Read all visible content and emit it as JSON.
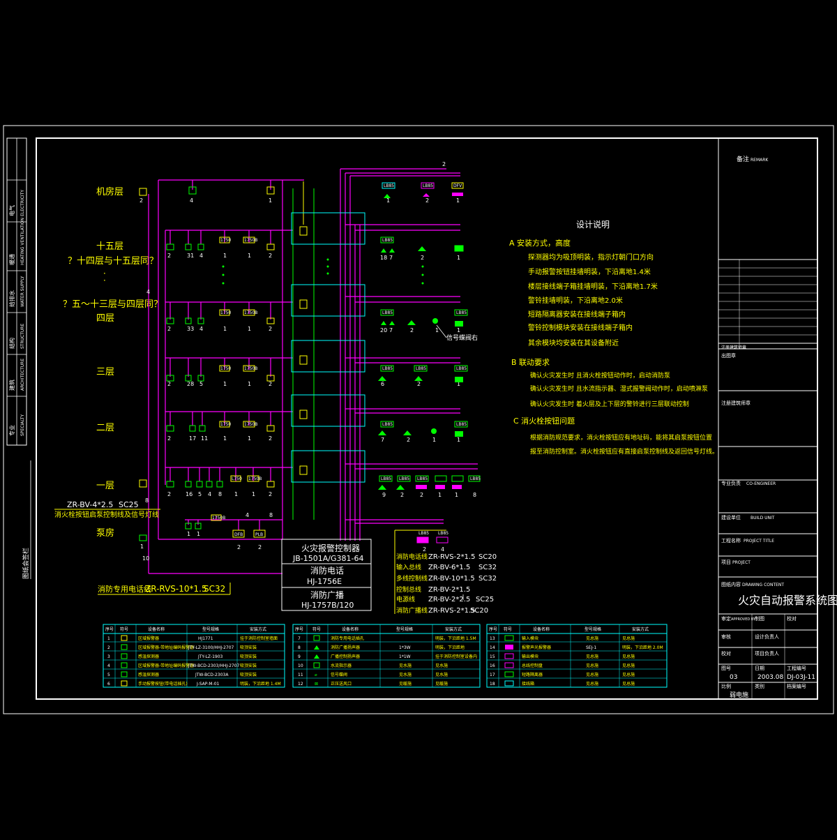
{
  "colors": {
    "background": "#000000",
    "frame": "#ffffff",
    "wire_magenta": "#ff00ff",
    "text_yellow": "#ffff00",
    "device_green": "#00ff00",
    "box_cyan": "#00ffff"
  },
  "floors": {
    "machine_room": "机房层",
    "f15": "十五层",
    "f14_15": "？十四层与十五层同？",
    "f5_13": "？五～十三层与四层同？",
    "f4": "四层",
    "f3": "三层",
    "f2": "二层",
    "f1": "一层",
    "pump_room": "泵房"
  },
  "counts": {
    "mr_2": "2",
    "mr_4": "4",
    "mr_1": "1",
    "f15_2a": "2",
    "f15_31": "31",
    "f15_4": "4",
    "f15_1a": "1",
    "f15_1b": "1",
    "f15_2b": "2",
    "f4_2a": "2",
    "f4_33": "33",
    "f4_4": "4",
    "f4_1a": "1",
    "f4_1b": "1",
    "f4_2b": "2",
    "f3_2a": "2",
    "f3_28": "28",
    "f3_5": "5",
    "f3_1a": "1",
    "f3_1b": "1",
    "f3_2b": "2",
    "f2_2a": "2",
    "f2_17": "17",
    "f2_11": "11",
    "f2_1a": "1",
    "f2_1b": "1",
    "f2_2b": "2",
    "f1_2a": "2",
    "f1_16": "16",
    "f1_5": "5",
    "f1_4": "4",
    "f1_8": "8",
    "f1_1a": "1",
    "f1_1b": "1",
    "f1_2b": "2",
    "pr_1a": "1",
    "pr_1b": "1",
    "pr_1c": "1",
    "pr_2a": "2",
    "pr_2b": "2",
    "r_mr_1": "1",
    "r_mr_2": "2",
    "r_mr_1b": "1",
    "r_15_18": "18",
    "r_15_7": "7",
    "r_15_2": "2",
    "r_15_1": "1",
    "r_4_20": "20",
    "r_4_7": "7",
    "r_4_2": "2",
    "r_4_1": "1",
    "r_4_1b": "1",
    "r_3_6": "6",
    "r_3_2": "2",
    "r_3_1": "1",
    "r_2_7": "7",
    "r_2_2": "2",
    "r_2_1": "1",
    "r_2_1b": "1",
    "r_1_9": "9",
    "r_1_2": "2",
    "r_1_2b": "2",
    "r_1_1": "1",
    "r_1_1b": "1",
    "r_1_8": "8",
    "r_p_2": "2",
    "r_p_4": "4",
    "wire_2": "2",
    "wire_4a": "4",
    "wire_4b": "4",
    "wire_8a": "8",
    "wire_8b": "8",
    "wire_10": "10"
  },
  "device_tags": {
    "mr_box": "LB85",
    "ll": "LL",
    "l2": "L2",
    "p2": "P2",
    "t1750": "1750",
    "t1750b": "1750B",
    "t1750b2": "1750B",
    "t1750b3": "1750B",
    "lb85": "LB85",
    "dfb": "DFB",
    "plb": "PLB",
    "dfv": "DFV",
    "l750": "L750"
  },
  "wire_labels": {
    "bv4": "ZR-BV-4*2.5",
    "sc25": "SC25",
    "bv4_desc": "消火栓按钮启泵控制线及信号灯线",
    "rvs10_label": "消防专用电话线",
    "rvs10": "ZR-RVS-10*1.5",
    "sc32": "SC32",
    "signal_pos": "信号蝶阀右"
  },
  "controller": {
    "title": "火灾报警控制器",
    "model": "JB-1501A/G381-64",
    "phone_title": "消防电话",
    "phone_model": "HJ-1756E",
    "bcast_title": "消防广播",
    "bcast_model": "HJ-1757B/120"
  },
  "cable_legend": [
    {
      "name": "消防电话线",
      "spec": "ZR-RVS-2*1.5",
      "pipe": "SC20"
    },
    {
      "name": "输入总线",
      "spec": "ZR-BV-6*1.5",
      "pipe": "SC32"
    },
    {
      "name": "多线控制线",
      "spec": "ZR-BV-10*1.5",
      "pipe": "SC32"
    },
    {
      "name": "控制总线",
      "spec": "ZR-BV-2*1.5",
      "pipe": ""
    },
    {
      "name": "电源线",
      "spec": "ZR-BV-2*2.5",
      "pipe": "SC25"
    },
    {
      "name": "消防广播线",
      "spec": "ZR-RVS-2*1.5",
      "pipe": "SC20"
    }
  ],
  "notes": {
    "title": "设计说明",
    "a_head": "A  安装方式，高度",
    "a1": "探测器均为吸顶明装，指示灯朝门口方向",
    "a2": "手动报警按钮挂墙明装，下沿离地1.4米",
    "a3": "楼层接线端子箱挂墙明装，下沿离地1.7米",
    "a4": "警铃挂墙明装，下沿离地2.0米",
    "a5": "短路隔离器安装在接线端子箱内",
    "a6": "警铃控制模块安装在接线端子箱内",
    "a7": "其余模块均安装在其设备附近",
    "b_head": "B  联动要求",
    "b1": "确认火灾发生时    且消火栓按钮动作时，启动消防泵",
    "b2": "确认火灾发生时    且水流指示器、湿式报警阀动作时，启动喷淋泵",
    "b3": "确认火灾发生时    着火层及上下层的警铃进行三层联动控制",
    "c_head": "C  消火栓按钮问题",
    "c1": "根据消防规范要求，消火栓按钮应有地址码，能将其启泵按钮位置",
    "c2": "报至消防控制室。消火栓按钮应有直接启泵控制线及返回信号灯线。"
  },
  "device_table_1": {
    "headers": [
      "序号",
      "符号",
      "设备名称",
      "型号规格",
      "安装方式"
    ],
    "rows": [
      [
        "1",
        "",
        "区域报警器",
        "HJ1771",
        "挂于消防控制室墙面"
      ],
      [
        "2",
        "",
        "区域报警器-带地址编码报警器",
        "JTY-LZ-3100/HHJ-2707",
        "吸顶安装"
      ],
      [
        "3",
        "",
        "感温探测器",
        "JTY-LZ-1903",
        "吸顶安装"
      ],
      [
        "4",
        "",
        "区域报警器-带地址编码报警器",
        "JTW-BCD-2303/HHJ-2707",
        "吸顶安装"
      ],
      [
        "5",
        "",
        "感温探测器",
        "JTW-BCD-2303A",
        "吸顶安装"
      ],
      [
        "6",
        "",
        "手动报警按钮(带电话插孔)",
        "J-SAP-M-01",
        "明装，下沿距地 1.4M"
      ]
    ]
  },
  "device_table_2": {
    "headers": [
      "序号",
      "符号",
      "设备名称",
      "型号规格",
      "安装方式"
    ],
    "rows": [
      [
        "7",
        "",
        "消防专用电话插孔",
        "",
        "明装，下沿距地 1.5M"
      ],
      [
        "8",
        "",
        "消防广播扬声器",
        "1*3W",
        "明装，下沿距地"
      ],
      [
        "9",
        "",
        "广播控制扬声器",
        "1*1W",
        "挂于消防控制室设备内"
      ],
      [
        "10",
        "",
        "水流指示器",
        "见水施",
        "见水施"
      ],
      [
        "11",
        "",
        "信号蝶阀",
        "见水施",
        "见水施"
      ],
      [
        "12",
        "",
        "正压送风口",
        "见暖施",
        "见暖施"
      ]
    ]
  },
  "device_table_3": {
    "headers": [
      "序号",
      "符号",
      "设备名称",
      "型号规格",
      "安装方式"
    ],
    "rows": [
      [
        "13",
        "",
        "输入模块",
        "见总施",
        "见总施"
      ],
      [
        "14",
        "",
        "报警声光报警器",
        "SEJ-1",
        "明装，下沿距地 2.0M"
      ],
      [
        "15",
        "",
        "输出模块",
        "见总施",
        "见总施"
      ],
      [
        "16",
        "",
        "总线控制盘",
        "见总施",
        "见总施"
      ],
      [
        "17",
        "",
        "短路隔离器",
        "见总施",
        "见总施"
      ],
      [
        "18",
        "",
        "接线箱",
        "见总施",
        "见总施"
      ]
    ]
  },
  "title_block": {
    "remark": "备注",
    "remark_en": "REMARK",
    "stamp_block": "出图章",
    "reg_stamp": "注册建筑师章",
    "chief": "专业负责",
    "chief_en": "CO-ENGINEER",
    "builder": "建设单位",
    "builder_en": "BUILD UNIT",
    "project": "工程名称",
    "project_en": "PROJECT TITLE",
    "item": "项目",
    "item_en": "PROJECT",
    "content": "图纸内容",
    "content_en": "DRAWING CONTENT",
    "drawing_title": "火灾自动报警系统图",
    "approved": "审定",
    "approved_en": "APPROVED BY",
    "drawn": "制图",
    "drawn_en": "DRAWN BY",
    "checked": "校对",
    "checked_en": "CHECKED BY",
    "designer": "设计负责人",
    "audit": "审核",
    "audit_en": "AUDITED BY",
    "pm": "项目负责人",
    "drawing_no": "图号",
    "drawing_no_val": "03",
    "date": "日期",
    "date_val": "2003.08",
    "proj_no": "工程编号",
    "proj_no_val": "DJ-03J-11",
    "category": "类别",
    "category_val": "弱电施",
    "scale": "比例",
    "archive": "档案编号",
    "side_labels": [
      "专业",
      "建筑",
      "结构",
      "给排水",
      "暖通",
      "电气"
    ],
    "side_labels_en": [
      "SPECIALTY",
      "ARCHITECTURE",
      "STRUCTURE",
      "WATER SUPPLY",
      "HEATING VENTILATION",
      "ELECTRICITY"
    ],
    "left_stamp": "图纸会签栏"
  }
}
